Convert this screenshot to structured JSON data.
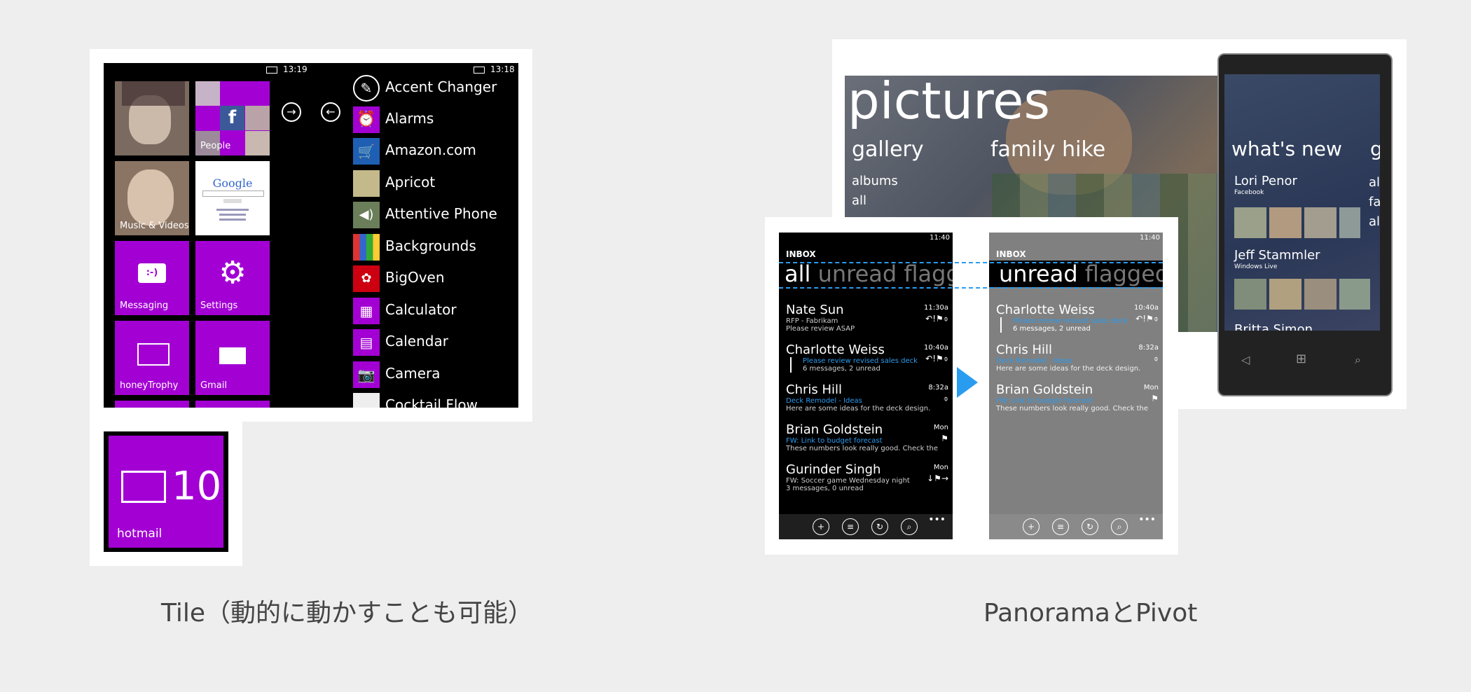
{
  "left": {
    "statusbar_left": {
      "time": "13:19"
    },
    "statusbar_right": {
      "time": "13:18"
    },
    "tiles": {
      "people": "People",
      "music": "Music & Videos",
      "messaging": "Messaging",
      "settings": "Settings",
      "honey": "honeyTrophy",
      "gmail": "Gmail",
      "google": "Google"
    },
    "apps": [
      "Accent Changer",
      "Alarms",
      "Amazon.com",
      "Apricot",
      "Attentive Phone",
      "Backgrounds",
      "BigOven",
      "Calculator",
      "Calendar",
      "Camera",
      "Cocktail Flow"
    ],
    "hotmail": {
      "count": "10",
      "label": "hotmail"
    },
    "caption": "Tile（動的に動かすことも可能）"
  },
  "right": {
    "panorama": {
      "title": "pictures",
      "sections": [
        "gallery",
        "family hike"
      ],
      "gallery_items": [
        "albums",
        "all"
      ],
      "whats_new": "what's new",
      "whats_new_next": "g",
      "side_letters": [
        "al",
        "fa",
        "al"
      ],
      "people": [
        {
          "name": "Lori Penor",
          "source": "Facebook"
        },
        {
          "name": "Jeff Stammler",
          "source": "Windows Live"
        },
        {
          "name": "Britta Simon",
          "source": ""
        }
      ]
    },
    "mail_black": {
      "time": "11:40",
      "inbox": "INBOX",
      "pivot_active": "all",
      "pivot_rest": "unread flagg",
      "messages": [
        {
          "from": "Nate Sun",
          "time": "11:30a",
          "subj": "RFP - Fabrikam",
          "prev": "Please review ASAP",
          "flags": "↶!⚑⌽"
        },
        {
          "from": "Charlotte Weiss",
          "time": "10:40a",
          "subj": "Please review revised sales deck",
          "prev": "6 messages, 2 unread",
          "flags": "↶!⚑⌽"
        },
        {
          "from": "Chris Hill",
          "time": "8:32a",
          "subj": "Deck Remodel - Ideas",
          "prev": "Here are some ideas for the deck design.",
          "flags": "⌽"
        },
        {
          "from": "Brian Goldstein",
          "time": "Mon",
          "subj": "FW: Link to budget forecast",
          "prev": "These numbers look really good. Check the",
          "flags": "⚑"
        },
        {
          "from": "Gurinder Singh",
          "time": "Mon",
          "subj": "FW: Soccer game Wednesday night",
          "prev": "3 messages, 0 unread",
          "flags": "↓⚑→"
        }
      ]
    },
    "mail_gray": {
      "time": "11:40",
      "inbox": "INBOX",
      "pivot_active": "unread",
      "pivot_rest": "flagged",
      "messages": [
        {
          "from": "Charlotte Weiss",
          "time": "10:40a",
          "subj": "Please review revised sales deck",
          "prev": "6 messages, 2 unread",
          "flags": "↶!⚑⌽"
        },
        {
          "from": "Chris Hill",
          "time": "8:32a",
          "subj": "Deck Remodel - Ideas",
          "prev": "Here are some ideas for the deck design.",
          "flags": "⌽"
        },
        {
          "from": "Brian Goldstein",
          "time": "Mon",
          "subj": "FW: Link to budget forecast",
          "prev": "These numbers look really good. Check the",
          "flags": "⚑"
        }
      ]
    },
    "caption": "PanoramaとPivot"
  },
  "colors": {
    "accent": "#a301d4",
    "blue": "#2a9cf0"
  }
}
